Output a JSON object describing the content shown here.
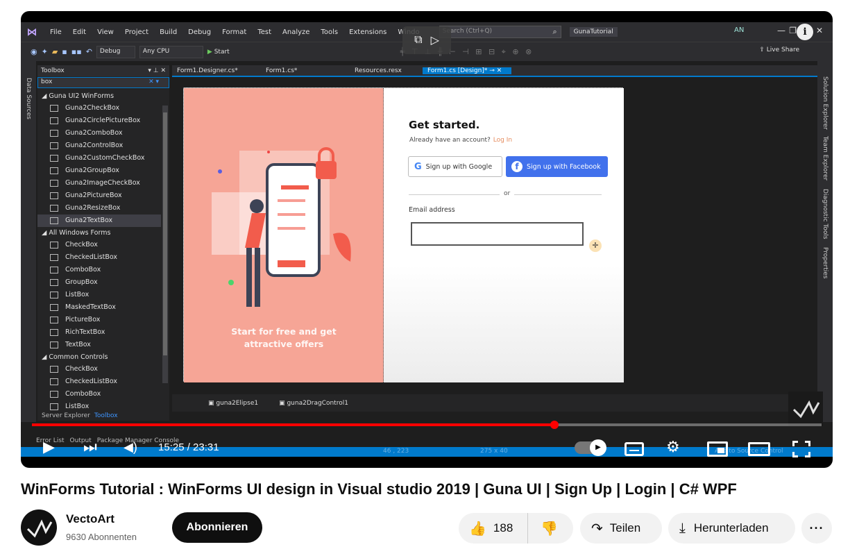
{
  "vs": {
    "menu": [
      "File",
      "Edit",
      "View",
      "Project",
      "Build",
      "Debug",
      "Format",
      "Test",
      "Analyze",
      "Tools",
      "Extensions",
      "Windo"
    ],
    "search_placeholder": "Search (Ctrl+Q)",
    "solution_name": "GunaTutorial",
    "user_initials": "AN",
    "toolbar": {
      "config": "Debug",
      "platform": "Any CPU",
      "start": "Start",
      "live_share": "Live Share"
    },
    "left_rail_label": "Data Sources",
    "right_rail": [
      "Solution Explorer",
      "Team Explorer",
      "Diagnostic Tools",
      "Properties"
    ],
    "toolbox": {
      "title": "Toolbox",
      "search": "box",
      "groups": [
        {
          "name": "Guna UI2 WinForms",
          "items": [
            "Guna2CheckBox",
            "Guna2CirclePictureBox",
            "Guna2ComboBox",
            "Guna2ControlBox",
            "Guna2CustomCheckBox",
            "Guna2GroupBox",
            "Guna2ImageCheckBox",
            "Guna2PictureBox",
            "Guna2ResizeBox",
            "Guna2TextBox"
          ]
        },
        {
          "name": "All Windows Forms",
          "items": [
            "CheckBox",
            "CheckedListBox",
            "ComboBox",
            "GroupBox",
            "ListBox",
            "MaskedTextBox",
            "PictureBox",
            "RichTextBox",
            "TextBox"
          ]
        },
        {
          "name": "Common Controls",
          "items": [
            "CheckBox",
            "CheckedListBox",
            "ComboBox",
            "ListBox"
          ]
        }
      ],
      "selected_item": "Guna2TextBox",
      "bottom_tabs": [
        "Server Explorer",
        "Toolbox"
      ]
    },
    "doc_tabs": [
      "Form1.Designer.cs*",
      "Form1.cs*",
      "Resources.resx",
      "Form1.cs [Design]*"
    ],
    "form": {
      "left_caption_line1": "Start for free and get",
      "left_caption_line2": "attractive offers",
      "heading": "Get started.",
      "have_account": "Already have an account?",
      "login_link": "Log In",
      "google_btn": "Sign up with Google",
      "facebook_btn": "Sign up with Facebook",
      "or": "or",
      "email_label": "Email address"
    },
    "components": [
      "guna2Elipse1",
      "guna2DragControl1"
    ],
    "bottom_tabs": [
      "Error List",
      "Output",
      "Package Manager Console"
    ],
    "status": {
      "position": "46 , 223",
      "size": "275 x 40",
      "source_control": "Add to Source Control"
    }
  },
  "player": {
    "time": "15:25 / 23:31",
    "progress_fraction": 0.662,
    "accent": "#ff0000"
  },
  "video": {
    "title": "WinForms Tutorial : WinForms UI design in Visual studio 2019 | Guna UI | Sign Up | Login | C# WPF",
    "channel": "VectoArt",
    "subscribers": "9630 Abonnenten",
    "subscribe_label": "Abonnieren",
    "likes": "188",
    "share_label": "Teilen",
    "download_label": "Herunterladen"
  }
}
